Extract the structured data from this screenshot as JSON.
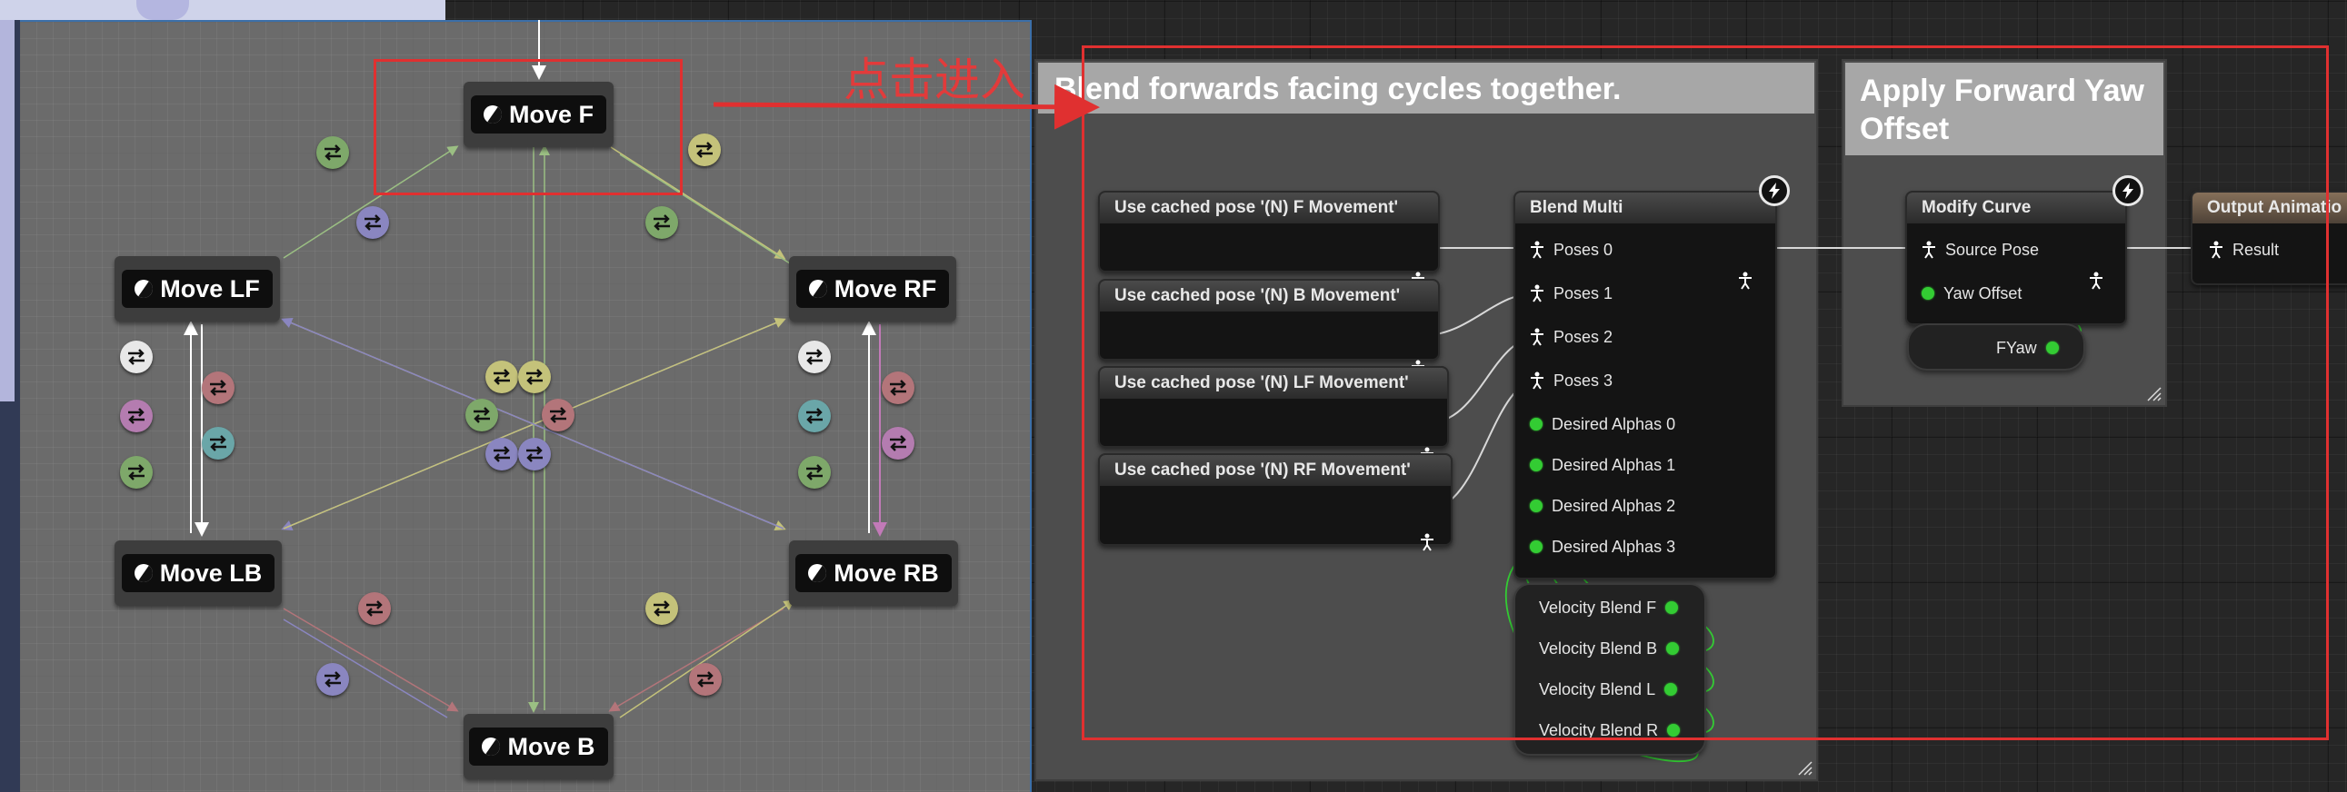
{
  "state_machine": {
    "states": [
      {
        "id": "F",
        "label": "Move F"
      },
      {
        "id": "LF",
        "label": "Move LF"
      },
      {
        "id": "RF",
        "label": "Move RF"
      },
      {
        "id": "LB",
        "label": "Move LB"
      },
      {
        "id": "RB",
        "label": "Move RB"
      },
      {
        "id": "B",
        "label": "Move B"
      }
    ]
  },
  "annotation": {
    "text": "点击进入",
    "color": "#e23b3b"
  },
  "blend_comment": {
    "title": "Blend forwards facing cycles together."
  },
  "cached_poses": [
    {
      "label": "Use cached pose '(N) F Movement'"
    },
    {
      "label": "Use cached pose '(N) B Movement'"
    },
    {
      "label": "Use cached pose '(N) LF Movement'"
    },
    {
      "label": "Use cached pose '(N) RF Movement'"
    }
  ],
  "blend_multi": {
    "title": "Blend Multi",
    "pose_inputs": [
      "Poses 0",
      "Poses 1",
      "Poses 2",
      "Poses 3"
    ],
    "alpha_inputs": [
      "Desired Alphas 0",
      "Desired Alphas 1",
      "Desired Alphas 2",
      "Desired Alphas 3"
    ]
  },
  "velocity_blend": {
    "outputs": [
      "Velocity Blend F",
      "Velocity Blend B",
      "Velocity Blend L",
      "Velocity Blend R"
    ]
  },
  "yaw_comment": {
    "title": "Apply Forward Yaw Offset"
  },
  "modify_curve": {
    "title": "Modify Curve",
    "source_pose": "Source Pose",
    "yaw_offset": "Yaw Offset"
  },
  "fyaw_var": {
    "label": "FYaw"
  },
  "output_animation": {
    "title": "Output Animatio",
    "result": "Result"
  },
  "colors": {
    "float_pin": "#33cc33",
    "comment_title": "#a7a7a7",
    "state_machine_bg": "#6b6b6b",
    "highlight_red": "#e03030"
  }
}
